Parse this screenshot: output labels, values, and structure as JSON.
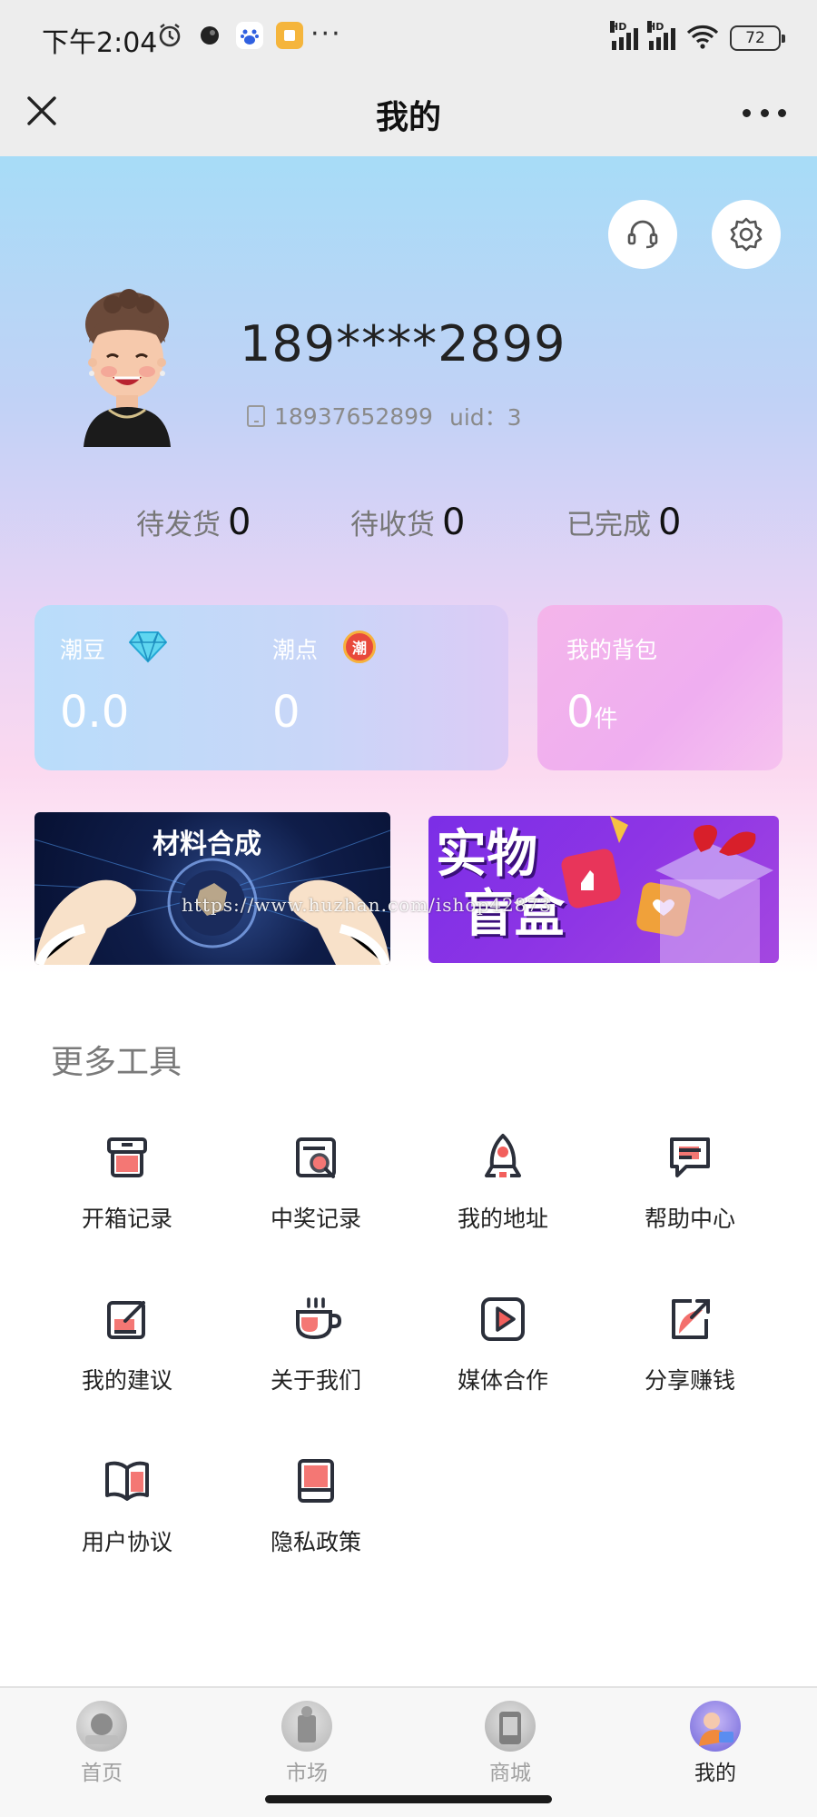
{
  "status_bar": {
    "time": "下午2:04",
    "more": "···",
    "battery": "72",
    "network_badge": "HD"
  },
  "nav": {
    "title": "我的"
  },
  "profile": {
    "username": "189****2899",
    "phone": "18937652899",
    "uid": "uid：3"
  },
  "orders": [
    {
      "label": "待发货",
      "count": "0"
    },
    {
      "label": "待收货",
      "count": "0"
    },
    {
      "label": "已完成",
      "count": "0"
    }
  ],
  "points": {
    "beans_label": "潮豆",
    "beans_value": "0.0",
    "points_label": "潮点",
    "points_value": "0",
    "points_badge": "潮"
  },
  "bag": {
    "label": "我的背包",
    "value": "0",
    "unit": "件"
  },
  "banners": {
    "left_title": "材料合成",
    "right_title_line1": "实物",
    "right_title_line2": "盲盒",
    "watermark": "https://www.huzhan.com/ishop42873"
  },
  "tools": {
    "title": "更多工具",
    "items": [
      {
        "label": "开箱记录",
        "icon": "box-record-icon"
      },
      {
        "label": "中奖记录",
        "icon": "prize-record-icon"
      },
      {
        "label": "我的地址",
        "icon": "location-rocket-icon"
      },
      {
        "label": "帮助中心",
        "icon": "help-chat-icon"
      },
      {
        "label": "我的建议",
        "icon": "suggestion-edit-icon"
      },
      {
        "label": "关于我们",
        "icon": "coffee-cup-icon"
      },
      {
        "label": "媒体合作",
        "icon": "media-play-icon"
      },
      {
        "label": "分享赚钱",
        "icon": "share-icon"
      },
      {
        "label": "用户协议",
        "icon": "book-open-icon"
      },
      {
        "label": "隐私政策",
        "icon": "privacy-book-icon"
      }
    ]
  },
  "tabbar": {
    "items": [
      {
        "label": "首页",
        "active": false
      },
      {
        "label": "市场",
        "active": false
      },
      {
        "label": "商城",
        "active": false
      },
      {
        "label": "我的",
        "active": true
      }
    ]
  },
  "colors": {
    "accent_red": "#f25f5c",
    "icon_stroke": "#2b2f3a",
    "bag_card": "#f0b1ee",
    "points_card": "#c4d9f9"
  }
}
